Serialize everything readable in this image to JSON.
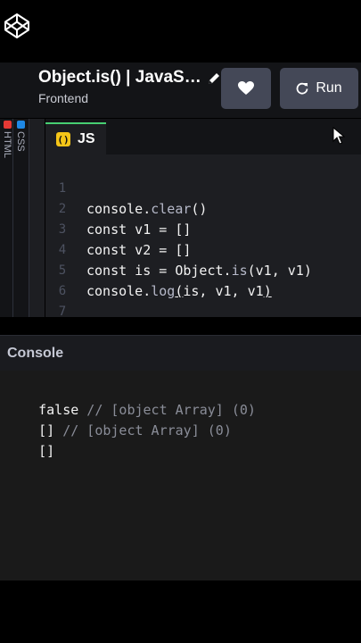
{
  "header": {
    "title": "Object.is() | JavaSc...",
    "subtitle": "Frontend",
    "run_label": "Run",
    "icons": [
      "codepen-logo-icon",
      "pencil-icon",
      "heart-icon",
      "refresh-icon"
    ]
  },
  "tabs": {
    "html_label": "HTML",
    "css_label": "CSS",
    "js_label": "JS",
    "js_badge": "()"
  },
  "editor": {
    "lines": [
      {
        "num": "1",
        "parts": [
          "console",
          ".",
          "clear",
          "()"
        ]
      },
      {
        "num": "2",
        "parts": [
          "const v1 = []"
        ]
      },
      {
        "num": "3",
        "parts": [
          "const v2 = []"
        ]
      },
      {
        "num": "4",
        "parts": [
          "const is = Object",
          ".",
          "is",
          "(v1, v1)"
        ]
      },
      {
        "num": "5",
        "parts": [
          "console",
          ".",
          "log",
          "(",
          "is, v1, v1",
          ")"
        ]
      },
      {
        "num": "6",
        "parts": []
      },
      {
        "num": "7",
        "parts": []
      }
    ]
  },
  "console": {
    "title": "Console",
    "lines": [
      {
        "value": "false",
        "comment": " // [object Array] (0)"
      },
      {
        "value": "[]",
        "comment": " // [object Array] (0)"
      },
      {
        "value": "[]",
        "comment": ""
      }
    ]
  },
  "colors": {
    "accent_green": "#47cf73",
    "js_yellow": "#f5c518",
    "html_red": "#e53935",
    "css_blue": "#1e88e5",
    "button_bg": "#444857"
  }
}
